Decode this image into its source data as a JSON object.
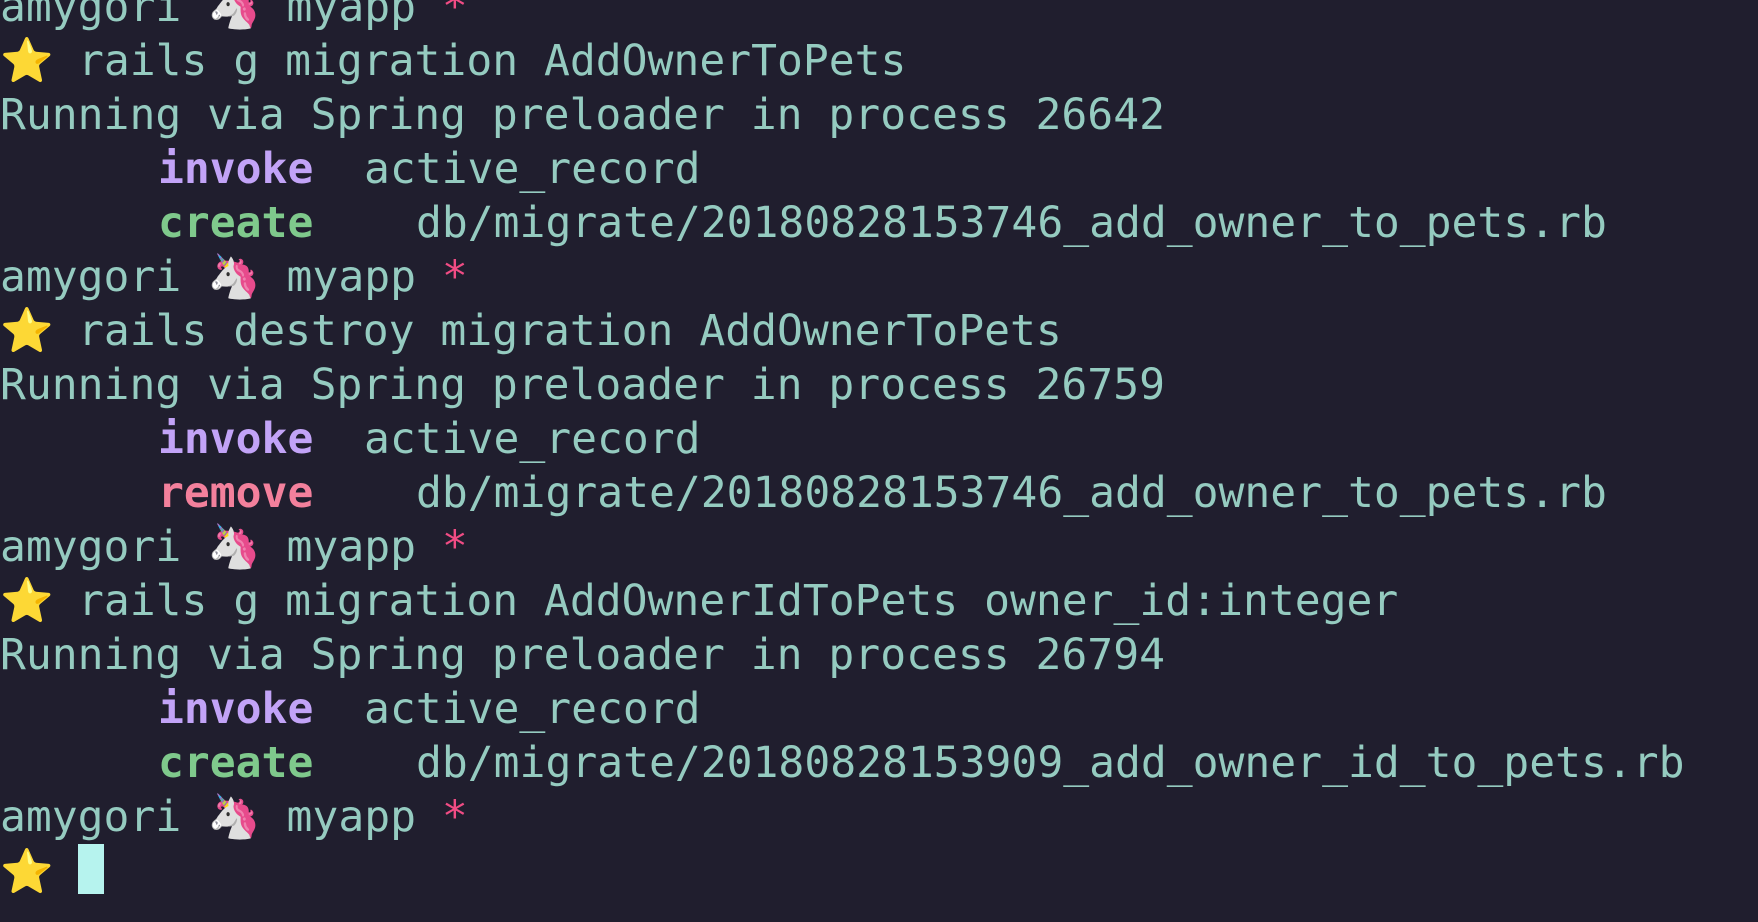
{
  "terminal": {
    "prompt": {
      "user": "amygori",
      "separator_icon": "🦄",
      "dir": "myapp",
      "dirty_marker": "*",
      "star_icon": "⭐"
    },
    "lines": [
      {
        "kind": "prompt"
      },
      {
        "kind": "command",
        "text": "rails g migration AddOwnerToPets"
      },
      {
        "kind": "output",
        "text": "Running via Spring preloader in process 26642"
      },
      {
        "kind": "action",
        "action": "invoke",
        "arg": "active_record"
      },
      {
        "kind": "action",
        "action": "create",
        "arg": "db/migrate/20180828153746_add_owner_to_pets.rb"
      },
      {
        "kind": "prompt"
      },
      {
        "kind": "command",
        "text": "rails destroy migration AddOwnerToPets"
      },
      {
        "kind": "output",
        "text": "Running via Spring preloader in process 26759"
      },
      {
        "kind": "action",
        "action": "invoke",
        "arg": "active_record"
      },
      {
        "kind": "action",
        "action": "remove",
        "arg": "db/migrate/20180828153746_add_owner_to_pets.rb"
      },
      {
        "kind": "prompt"
      },
      {
        "kind": "command",
        "text": "rails g migration AddOwnerIdToPets owner_id:integer"
      },
      {
        "kind": "output",
        "text": "Running via Spring preloader in process 26794"
      },
      {
        "kind": "action",
        "action": "invoke",
        "arg": "active_record"
      },
      {
        "kind": "action",
        "action": "create",
        "arg": "db/migrate/20180828153909_add_owner_id_to_pets.rb"
      },
      {
        "kind": "prompt"
      },
      {
        "kind": "input",
        "text": ""
      }
    ]
  },
  "colors": {
    "background": "#201e2e",
    "text": "#95cbc0",
    "invoke": "#c2a3f7",
    "create": "#7fc98c",
    "remove": "#f3809c",
    "dirty_marker": "#f04c84",
    "cursor": "#b6f3ee"
  }
}
